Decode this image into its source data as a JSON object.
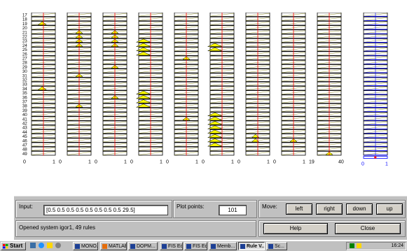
{
  "viewer": {
    "row_labels": [
      "17",
      "18",
      "19",
      "20",
      "21",
      "22",
      "23",
      "24",
      "25",
      "26",
      "27",
      "28",
      "29",
      "30",
      "31",
      "32",
      "33",
      "34",
      "35",
      "36",
      "37",
      "38",
      "39",
      "40",
      "41",
      "42",
      "43",
      "44",
      "45",
      "46",
      "47",
      "48",
      "49"
    ],
    "inputs": [
      {
        "min_label": "0",
        "max_label": "1",
        "value": 0.5,
        "peaks": [
          {
            "row": 19,
            "pos": 0.45,
            "w": 0.35
          },
          {
            "row": 34,
            "pos": 0.45,
            "w": 0.35
          }
        ]
      },
      {
        "min_label": "0",
        "max_label": "1",
        "value": 0.5,
        "peaks": [
          {
            "row": 21,
            "pos": 0.5,
            "w": 0.3
          },
          {
            "row": 22,
            "pos": 0.5,
            "w": 0.3
          },
          {
            "row": 23,
            "pos": 0.5,
            "w": 0.3
          },
          {
            "row": 24,
            "pos": 0.5,
            "w": 0.3
          },
          {
            "row": 31,
            "pos": 0.5,
            "w": 0.3
          },
          {
            "row": 38,
            "pos": 0.5,
            "w": 0.3
          }
        ]
      },
      {
        "min_label": "0",
        "max_label": "1",
        "value": 0.5,
        "peaks": [
          {
            "row": 21,
            "pos": 0.5,
            "w": 0.3
          },
          {
            "row": 22,
            "pos": 0.5,
            "w": 0.3
          },
          {
            "row": 23,
            "pos": 0.5,
            "w": 0.3
          },
          {
            "row": 24,
            "pos": 0.5,
            "w": 0.3
          },
          {
            "row": 29,
            "pos": 0.5,
            "w": 0.3
          },
          {
            "row": 36,
            "pos": 0.5,
            "w": 0.3
          }
        ]
      },
      {
        "min_label": "0",
        "max_label": "1",
        "value": 0.5,
        "peaks": [
          {
            "row": 23,
            "pos": 0.2,
            "w": 0.6
          },
          {
            "row": 24,
            "pos": 0.2,
            "w": 0.6
          },
          {
            "row": 25,
            "pos": 0.2,
            "w": 0.6
          },
          {
            "row": 26,
            "pos": 0.2,
            "w": 0.6
          },
          {
            "row": 35,
            "pos": 0.2,
            "w": 0.6
          },
          {
            "row": 36,
            "pos": 0.2,
            "w": 0.6
          },
          {
            "row": 37,
            "pos": 0.2,
            "w": 0.6
          },
          {
            "row": 38,
            "pos": 0.2,
            "w": 0.6
          }
        ]
      },
      {
        "min_label": "0",
        "max_label": "1",
        "value": 0.5,
        "peaks": [
          {
            "row": 27,
            "pos": 0.5,
            "w": 0.3
          },
          {
            "row": 41,
            "pos": 0.5,
            "w": 0.3
          }
        ]
      },
      {
        "min_label": "0",
        "max_label": "1",
        "value": 0.5,
        "peaks": [
          {
            "row": 24,
            "pos": 0.2,
            "w": 0.6
          },
          {
            "row": 25,
            "pos": 0.2,
            "w": 0.6
          },
          {
            "row": 40,
            "pos": 0.2,
            "w": 0.6
          },
          {
            "row": 41,
            "pos": 0.2,
            "w": 0.6
          },
          {
            "row": 42,
            "pos": 0.2,
            "w": 0.6
          },
          {
            "row": 43,
            "pos": 0.2,
            "w": 0.6
          },
          {
            "row": 44,
            "pos": 0.2,
            "w": 0.6
          },
          {
            "row": 45,
            "pos": 0.2,
            "w": 0.6
          },
          {
            "row": 46,
            "pos": 0.2,
            "w": 0.6
          },
          {
            "row": 47,
            "pos": 0.2,
            "w": 0.6
          }
        ]
      },
      {
        "min_label": "0",
        "max_label": "1",
        "value": 0.5,
        "peaks": [
          {
            "row": 45,
            "pos": 0.4,
            "w": 0.3
          },
          {
            "row": 46,
            "pos": 0.4,
            "w": 0.3
          }
        ]
      },
      {
        "min_label": "0",
        "max_label": "1",
        "value": 0.5,
        "peaks": [
          {
            "row": 46,
            "pos": 0.5,
            "w": 0.3
          }
        ]
      },
      {
        "min_label": "19",
        "max_label": "40",
        "value": 29.5,
        "peaks": [
          {
            "row": 49,
            "pos": 0.5,
            "w": 0.3
          }
        ]
      }
    ],
    "output": {
      "min_label": "0",
      "max_label": "1"
    }
  },
  "controls": {
    "input_label": "Input:",
    "input_value": "[0.5 0.5 0.5 0.5 0.5 0.5 0.5 0.5 29.5]",
    "plot_points_label": "Plot points:",
    "plot_points_value": "101",
    "move_label": "Move:",
    "move_buttons": {
      "left": "left",
      "right": "right",
      "down": "down",
      "up": "up"
    },
    "status": "Opened system igor1, 49 rules",
    "help": "Help",
    "close": "Close"
  },
  "taskbar": {
    "start": "Start",
    "tasks": [
      "MONO...",
      "MATLAB",
      "DOPM...",
      "FIS Ed...",
      "FIS Ed...",
      "Memb...",
      "Rule V...",
      "Sc..."
    ],
    "active_index": 6,
    "clock": "16:24"
  },
  "colors": {
    "fill": "#ffff00",
    "line": "#ff0000",
    "rule_line": "#808000",
    "output_blue": "#0000ff"
  }
}
